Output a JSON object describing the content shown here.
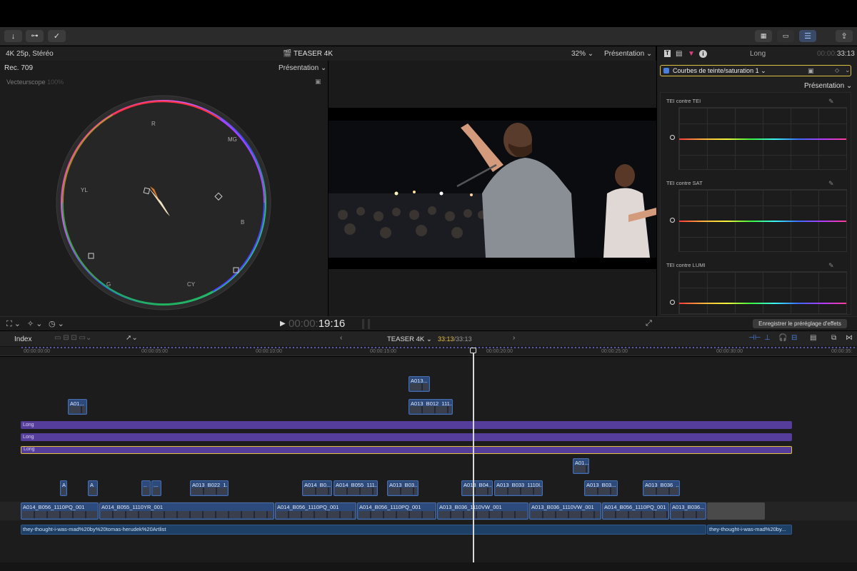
{
  "toolbar": {
    "import_icon": "arrow-down-icon",
    "keyword_icon": "key-icon",
    "check_icon": "check-circle-icon",
    "share_icon": "share-icon"
  },
  "viewer": {
    "format": "4K 25p, Stéréo",
    "title": "TEASER 4K",
    "zoom": "32%",
    "presentation": "Présentation",
    "timecode_dim": "00:00:",
    "timecode": "19:16"
  },
  "scope": {
    "colorspace": "Rec. 709",
    "presentation": "Présentation",
    "label": "Vecteurscope",
    "percent": "100%",
    "markers": {
      "r": "R",
      "mg": "MG",
      "yl": "YL",
      "b": "B",
      "g": "G",
      "cy": "CY"
    }
  },
  "inspector": {
    "duration_label": "Long",
    "timecode_dim": "00:00:",
    "timecode": "33:13",
    "effect": "Courbes de teinte/saturation 1",
    "presentation": "Présentation",
    "curves": [
      "TEI contre TEI",
      "TEI contre SAT",
      "TEI contre LUMI"
    ],
    "save_preset": "Enregistrer le préréglage d'effets"
  },
  "timeline": {
    "index": "Index",
    "project": "TEASER 4K",
    "position": "33:13",
    "total": "33:13",
    "ruler": [
      "00:00:00:00",
      "00:00:05:00",
      "00:00:10:00",
      "00:00:15:00",
      "00:00:20:00",
      "00:00:25:00",
      "00:00:30:00",
      "00:00:35:"
    ],
    "adjust_bars": [
      "Long",
      "Long",
      "Long"
    ],
    "clips_top": [
      "A013...",
      "A013_B012_111...",
      "A01...",
      "A01..."
    ],
    "clips_connected": [
      "A",
      "A",
      "..",
      "...",
      "A013_B022_1...",
      "A014_B0...",
      "A014_B055_111...",
      "A013_B03...",
      "A013_B04...",
      "A013_B033_1110I...",
      "A013_B03...",
      "A013_B036_..."
    ],
    "clips_primary": [
      "A014_B056_1110PQ_001",
      "A014_B055_1110YR_001",
      "A014_B056_1110PQ_001",
      "A014_B056_1110PQ_001",
      "A013_B036_1110VW_001",
      "A013_B036_1110VW_001",
      "A014_B056_1110PQ_001",
      "A013_B036..."
    ],
    "audio": [
      "they-thought-i-was-mad%20by%20tomas-herudek%20Artlist",
      "they-thought-i-was-mad%20by..."
    ]
  },
  "colors": {
    "accent": "#f0c040",
    "clip": "#2c4a7c",
    "adjust": "#553e9b",
    "audio": "#1e3f66"
  }
}
